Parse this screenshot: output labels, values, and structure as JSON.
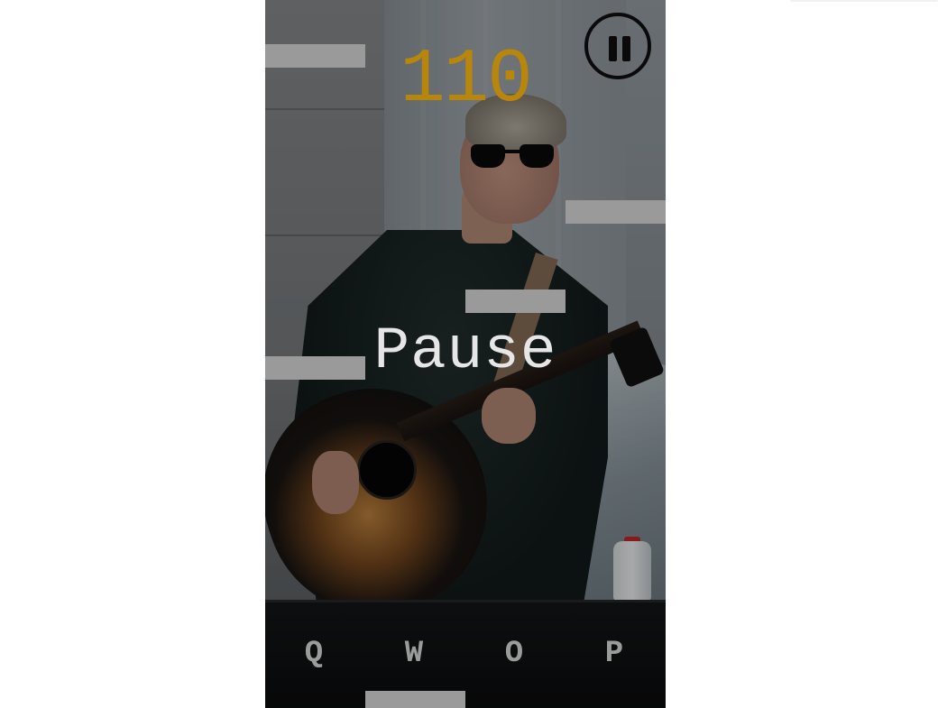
{
  "score": "110",
  "overlay": {
    "label": "Pause"
  },
  "controls": {
    "pause_icon": "pause-icon",
    "keys": [
      "Q",
      "W",
      "O",
      "P"
    ]
  },
  "colors": {
    "score": "#b8860b",
    "tile": "#9a9a9a",
    "overlay_text": "#e6e6e6",
    "key_text": "#9b9b9b"
  }
}
